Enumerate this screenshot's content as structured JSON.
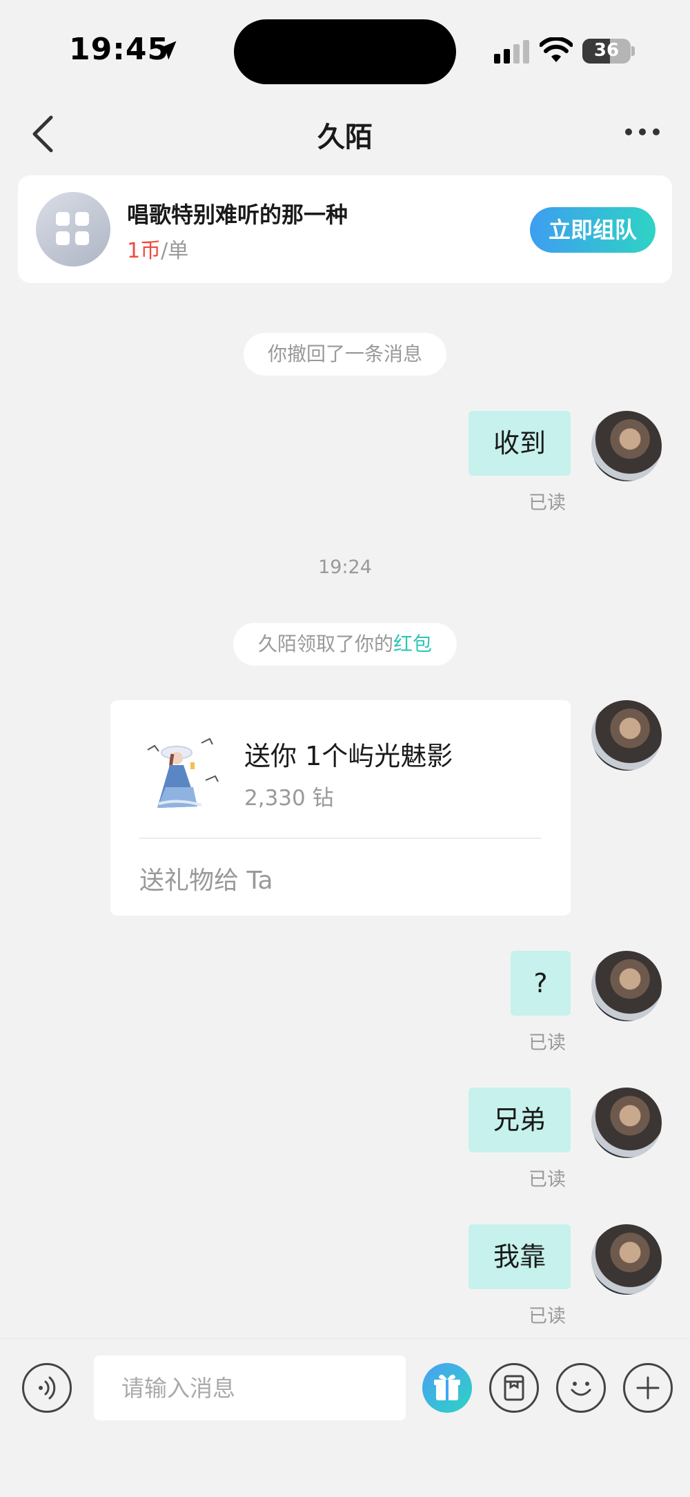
{
  "status_bar": {
    "time": "19:45",
    "battery": "36"
  },
  "nav": {
    "title": "久陌"
  },
  "team_card": {
    "title": "唱歌特别难听的那一种",
    "price_amount": "1币",
    "price_unit": "/单",
    "join_label": "立即组队"
  },
  "messages": {
    "recall_notice": "你撤回了一条消息",
    "msg1": {
      "text": "收到",
      "status": "已读"
    },
    "timestamp": "19:24",
    "redpacket_notice": {
      "prefix": "久陌领取了你的",
      "link": "红包"
    },
    "gift": {
      "title": "送你 1个屿光魅影",
      "price": "2,330 钻",
      "action": "送礼物给 Ta"
    },
    "msg2": {
      "text": "?",
      "status": "已读"
    },
    "msg3": {
      "text": "兄弟",
      "status": "已读"
    },
    "msg4": {
      "text": "我靠",
      "status": "已读"
    }
  },
  "input_bar": {
    "placeholder": "请输入消息"
  },
  "icons": {
    "back": "chevron-left-icon",
    "more": "more-dots-icon",
    "voice": "voice-icon",
    "gift": "gift-icon",
    "sticker": "sticker-icon",
    "emoji": "emoji-icon",
    "plus": "plus-icon"
  },
  "colors": {
    "accent_teal": "#2fc5b5",
    "bubble": "#c6f1ec",
    "price_red": "#f04a3e",
    "join_gradient_start": "#3d9ef0"
  }
}
